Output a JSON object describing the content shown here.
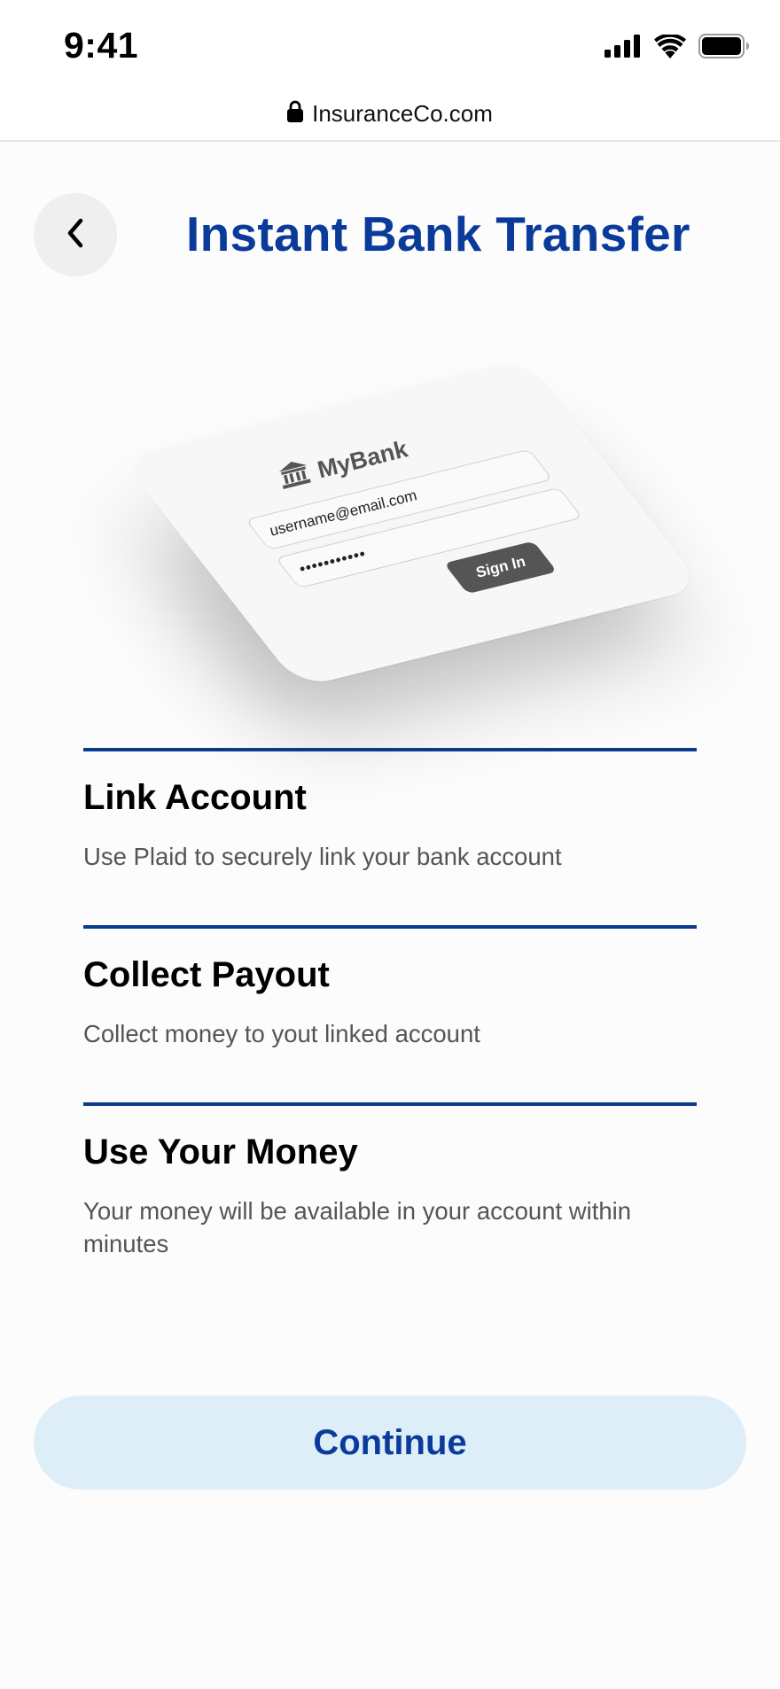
{
  "status_bar": {
    "time": "9:41",
    "icons": [
      "cellular-signal-icon",
      "wifi-icon",
      "battery-icon"
    ]
  },
  "browser": {
    "url": "InsuranceCo.com",
    "lock_icon": "lock-icon"
  },
  "header": {
    "back_icon": "chevron-left-icon",
    "title": "Instant Bank Transfer"
  },
  "illustration": {
    "bank_name": "MyBank",
    "bank_icon": "bank-icon",
    "username_value": "username@email.com",
    "password_value": "•••••••••••",
    "signin_label": "Sign In"
  },
  "steps": [
    {
      "title": "Link Account",
      "description": "Use Plaid to securely link your bank account"
    },
    {
      "title": "Collect Payout",
      "description": "Collect money to yout linked account"
    },
    {
      "title": "Use Your Money",
      "description": "Your money will be available in your account within minutes"
    }
  ],
  "continue_label": "Continue",
  "colors": {
    "title_blue": "#0b3b9a",
    "divider_blue": "#0b3b8f",
    "button_bg": "#ddeef9",
    "back_button_bg": "#efefef",
    "description_gray": "#555555"
  }
}
